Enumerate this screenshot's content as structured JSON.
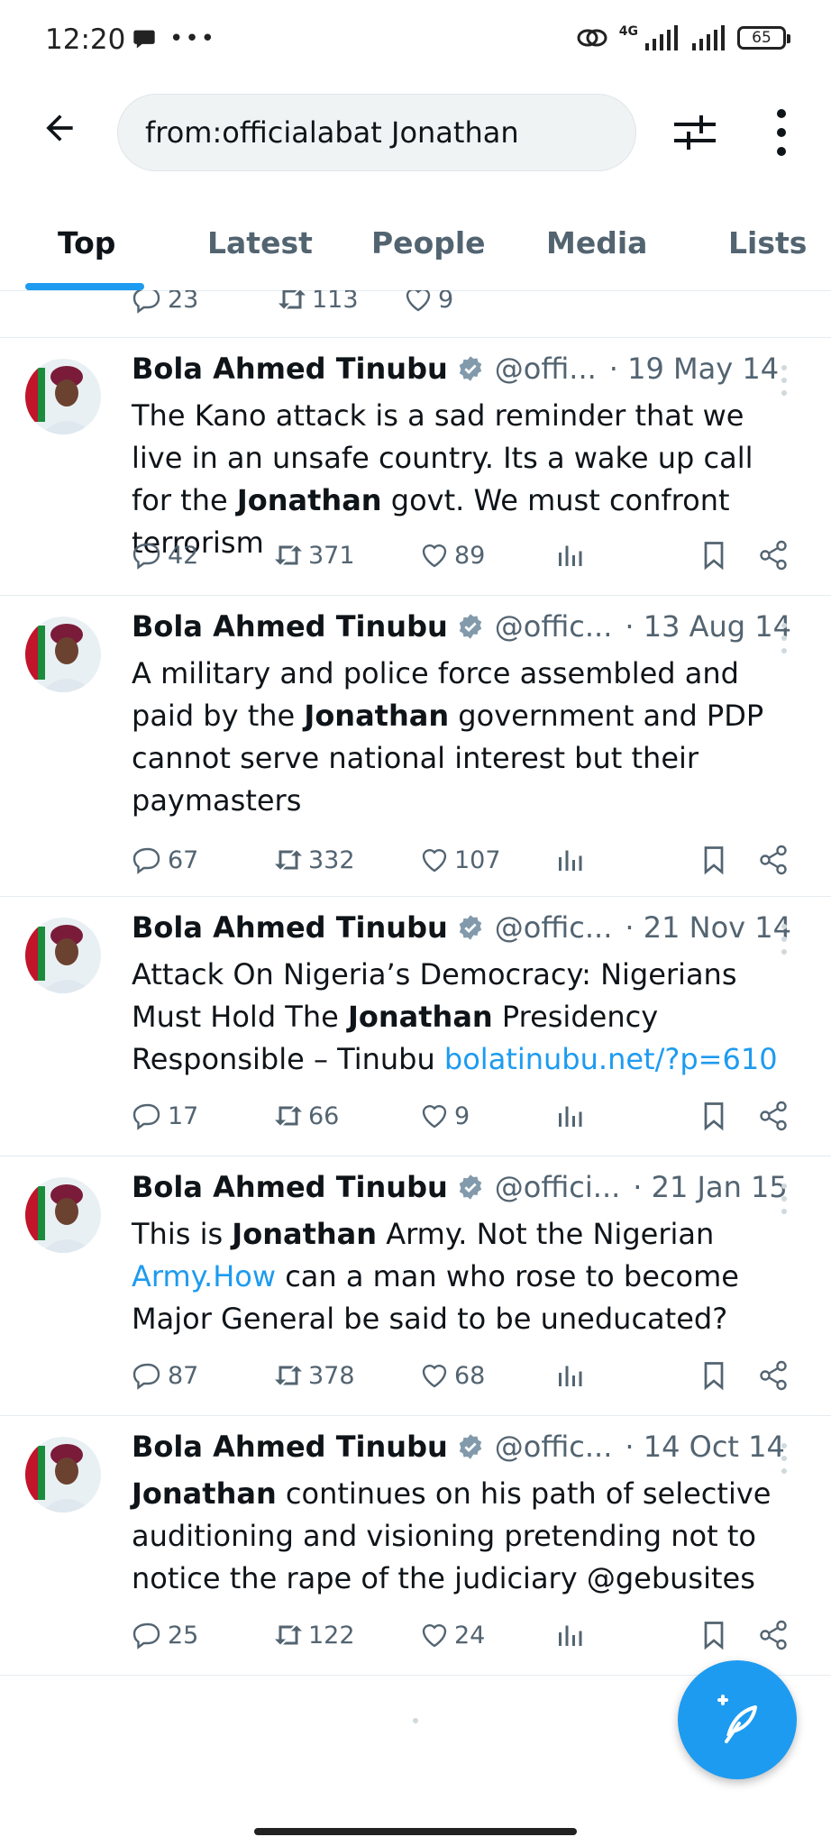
{
  "status_bar": {
    "time": "12:20",
    "network": "4G",
    "battery": "65"
  },
  "search": {
    "query": "from:officialabat Jonathan"
  },
  "tabs": [
    {
      "label": "Top",
      "active": true
    },
    {
      "label": "Latest"
    },
    {
      "label": "People"
    },
    {
      "label": "Media"
    },
    {
      "label": "Lists"
    }
  ],
  "partial_tweet": {
    "replies": "23",
    "retweets": "113",
    "likes": "9"
  },
  "tweets": [
    {
      "name": "Bola Ahmed Tinubu",
      "handle": "@offi...",
      "date": "· 19 May 14",
      "text_parts": [
        "The Kano attack is a sad reminder that we live in an unsafe country. Its a wake up call for the ",
        "Jonathan",
        " govt. We must confront terrorism"
      ],
      "replies": "42",
      "retweets": "371",
      "likes": "89"
    },
    {
      "name": "Bola Ahmed Tinubu",
      "handle": "@offic...",
      "date": "· 13 Aug 14",
      "text_parts": [
        "A military and police force assembled and paid by the ",
        "Jonathan",
        " government and PDP cannot serve national interest but their paymasters"
      ],
      "replies": "67",
      "retweets": "332",
      "likes": "107"
    },
    {
      "name": "Bola Ahmed Tinubu",
      "handle": "@offic...",
      "date": "· 21 Nov 14",
      "text_parts": [
        "Attack On Nigeria’s Democracy: Nigerians Must Hold The ",
        "Jonathan",
        " Presidency Responsible – Tinubu "
      ],
      "link": "bolatinubu.net/?p=610",
      "replies": "17",
      "retweets": "66",
      "likes": "9"
    },
    {
      "name": "Bola Ahmed Tinubu",
      "handle": "@offici...",
      "date": "· 21 Jan 15",
      "text_parts": [
        "This is ",
        "Jonathan",
        " Army. Not the Nigerian "
      ],
      "link": "Army.How",
      "text_after": " can a man who rose to become Major General be said to be uneducated?",
      "replies": "87",
      "retweets": "378",
      "likes": "68"
    },
    {
      "name": "Bola Ahmed Tinubu",
      "handle": "@offic...",
      "date": "· 14 Oct 14",
      "text_parts": [
        "",
        "Jonathan",
        " continues on his path of selective auditioning and visioning pretending not to notice the rape of the judiciary  @gebusites"
      ],
      "replies": "25",
      "retweets": "122",
      "likes": "24"
    }
  ],
  "colors": {
    "accent": "#1d9bf0",
    "text": "#0f1419",
    "muted": "#536471"
  }
}
